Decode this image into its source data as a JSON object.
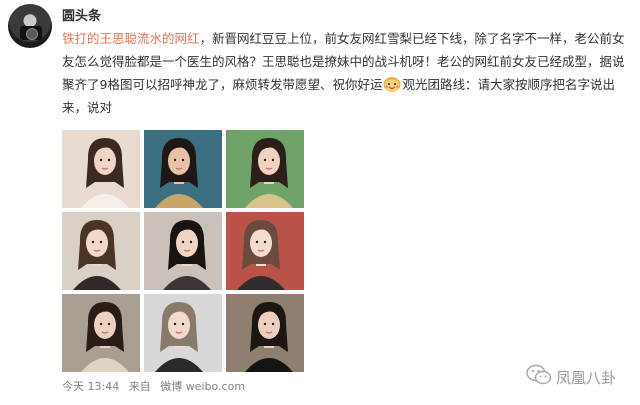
{
  "post": {
    "username": "圆头条",
    "topic_link": "铁打的王思聪流水的网红",
    "text_part1": "，新晋网红豆豆上位，前女友网红雪梨已经下线，除了名字不一样，老公前女友怎么觉得脸都是一个医生的风格？王思聪也是撩妹中的战斗机呀！老公的网红前女友已经成型，据说聚齐了9格图可以招呼神龙了，麻烦转发带愿望、祝你好运",
    "text_part2": "观光团路线：请大家按顺序把名字说出来，说对",
    "emoji_name": "happy-face-emoji",
    "timestamp": "今天 13:44",
    "source_label": "来自",
    "source": "微博 weibo.com",
    "photos": [
      {
        "name": "photo-1",
        "skin": "#f1d6c6",
        "hair": "#3a2a22",
        "bg": "#e8dcd2",
        "cloth": "#f4efe9"
      },
      {
        "name": "photo-2",
        "skin": "#e6c3a8",
        "hair": "#1e1814",
        "bg": "#3d6f82",
        "cloth": "#c8a66a"
      },
      {
        "name": "photo-3",
        "skin": "#f0d2bf",
        "hair": "#2b1f19",
        "bg": "#6fa36a",
        "cloth": "#d9c38a"
      },
      {
        "name": "photo-4",
        "skin": "#f2d8c9",
        "hair": "#4a3426",
        "bg": "#d9d0c6",
        "cloth": "#2f2a28"
      },
      {
        "name": "photo-5",
        "skin": "#efd5c4",
        "hair": "#1a1411",
        "bg": "#c9c1ba",
        "cloth": "#3b3535"
      },
      {
        "name": "photo-6",
        "skin": "#f3dbcd",
        "hair": "#6b4b3e",
        "bg": "#b9534a",
        "cloth": "#2d2d2d"
      },
      {
        "name": "photo-7",
        "skin": "#ecd0be",
        "hair": "#2a1d17",
        "bg": "#a89f92",
        "cloth": "#ddd4c4"
      },
      {
        "name": "photo-8",
        "skin": "#f2d9cb",
        "hair": "#8a7a6c",
        "bg": "#d8d8d8",
        "cloth": "#2a2a2a"
      },
      {
        "name": "photo-9",
        "skin": "#eccfbf",
        "hair": "#1d1713",
        "bg": "#8f7f70",
        "cloth": "#141414"
      }
    ]
  },
  "watermark": {
    "label": "凤凰八卦",
    "icon": "wechat-icon"
  },
  "colors": {
    "link": "#eb7350",
    "text": "#333333",
    "meta": "#808080"
  }
}
